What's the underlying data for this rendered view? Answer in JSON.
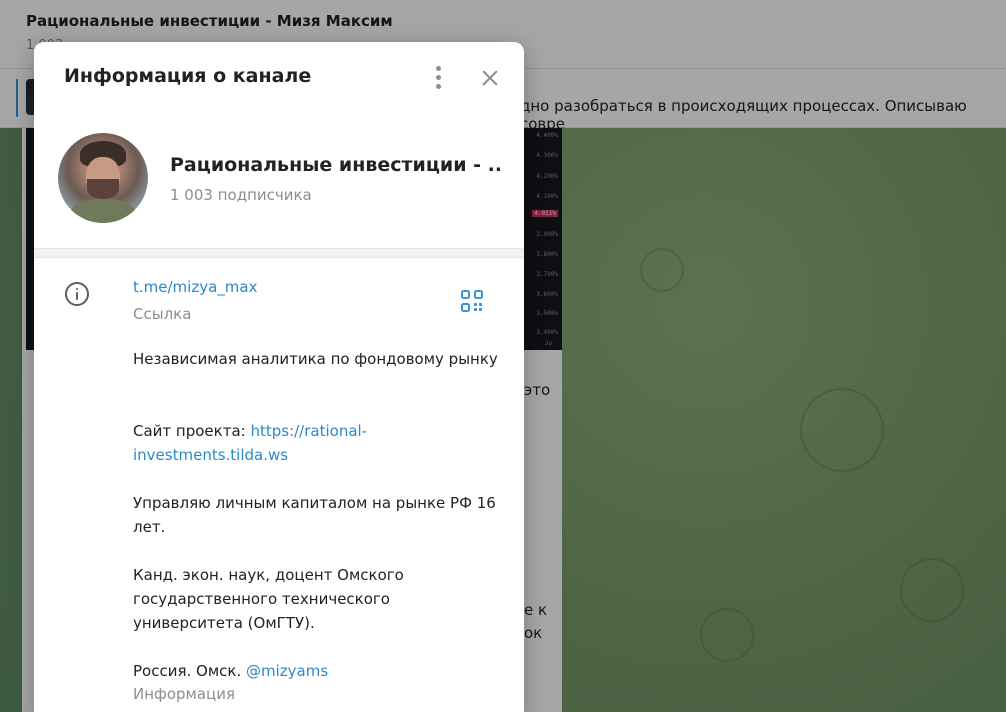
{
  "background": {
    "chat_title": "Рациональные инвестиции - Мизя Максим",
    "chat_subtitle": "1 003",
    "pinned_text": "дно разобраться в происходящих процессах. Описываю совре",
    "fragment_1": "это",
    "fragment_2": "е к",
    "fragment_3": "ок",
    "chart_prices": [
      "4.400%",
      "4.300%",
      "4.200%",
      "4.100%",
      "4.011%",
      "3.900%",
      "3.800%",
      "3.700%",
      "3.600%",
      "3.500%",
      "3.400%"
    ],
    "chart_corner": "Ju"
  },
  "modal": {
    "title": "Информация о канале",
    "channel_name": "Рациональные инвестиции - ...",
    "subscribers": "1 003 подписчика",
    "link": "t.me/mizya_max",
    "link_caption": "Ссылка",
    "desc_line1": "Независимая аналитика по фондовому рынку",
    "desc_site_prefix": "Сайт проекта: ",
    "desc_site_link": "https://rational-investments.tilda.ws",
    "desc_line3": "Управляю личным капиталом на рынке РФ 16 лет.",
    "desc_line4": "Канд. экон. наук, доцент Омского государственного технического университета (ОмГТУ).",
    "desc_line5_prefix": "Россия. Омск. ",
    "desc_line5_handle": "@mizyams",
    "info_caption": "Информация"
  },
  "icons": {
    "menu": "more-vertical-icon",
    "close": "close-icon",
    "info": "info-icon",
    "qr": "qr-code-icon"
  },
  "colors": {
    "link": "#2b8ac6",
    "muted": "#8a8f96",
    "text": "#222222"
  }
}
